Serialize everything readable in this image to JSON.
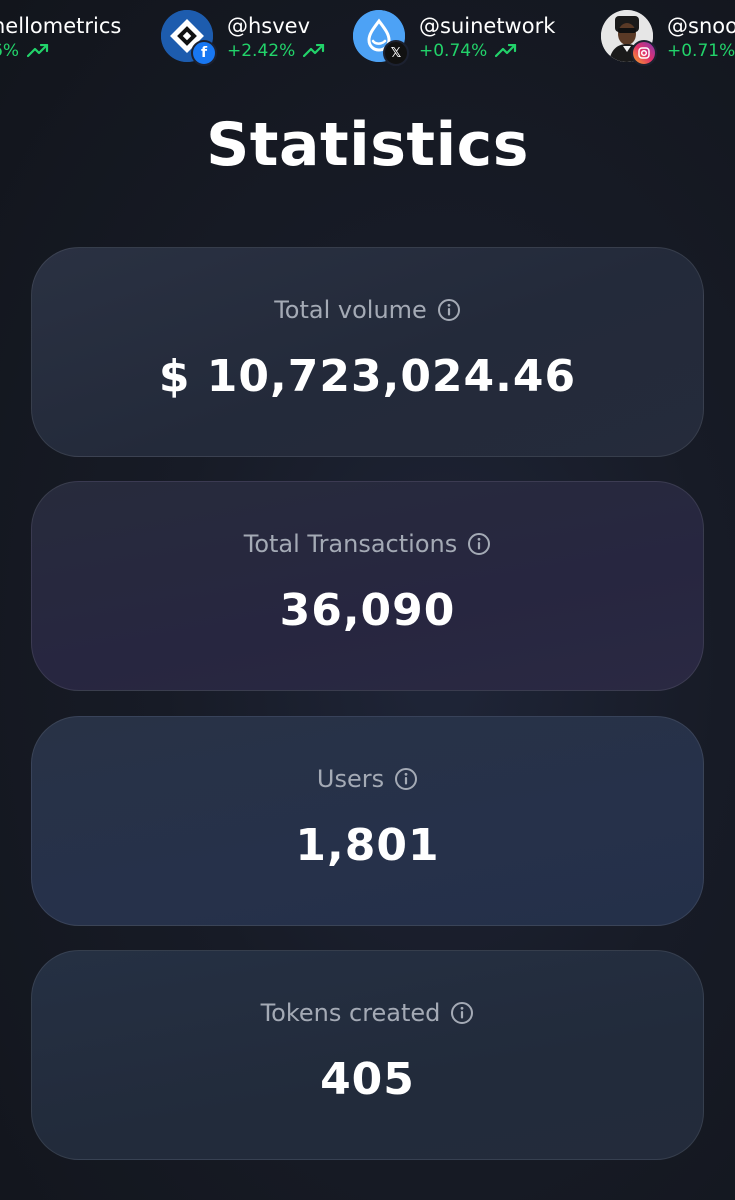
{
  "ticker": {
    "items": [
      {
        "handle": "nellometrics",
        "change": "6%",
        "avatar_icon": "none",
        "badge_icon": "none"
      },
      {
        "handle": "@hsvev",
        "change": "+2.42%",
        "avatar_icon": "diamond-logo-icon",
        "badge_icon": "facebook-icon"
      },
      {
        "handle": "@suinetwork",
        "change": "+0.74%",
        "avatar_icon": "water-drop-logo-icon",
        "badge_icon": "x-icon"
      },
      {
        "handle": "@snoo",
        "change": "+0.71%",
        "avatar_icon": "person-photo-icon",
        "badge_icon": "instagram-icon"
      }
    ],
    "trend_icon": "trending-up-icon",
    "positive_color": "#22d36a"
  },
  "page": {
    "title": "Statistics"
  },
  "stats": [
    {
      "label": "Total volume",
      "value": "$ 10,723,024.46",
      "icon": "info-icon"
    },
    {
      "label": "Total Transactions",
      "value": "36,090",
      "icon": "info-icon"
    },
    {
      "label": "Users",
      "value": "1,801",
      "icon": "info-icon"
    },
    {
      "label": "Tokens created",
      "value": "405",
      "icon": "info-icon"
    }
  ]
}
